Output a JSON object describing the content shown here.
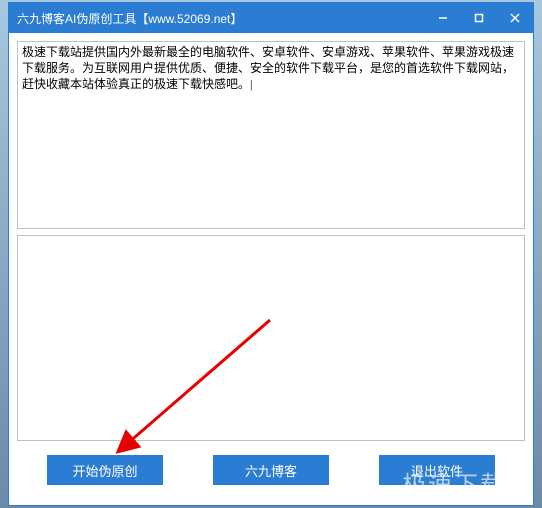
{
  "window": {
    "title": "六九博客AI伪原创工具【www.52069.net】"
  },
  "input": {
    "text": "极速下载站提供国内外最新最全的电脑软件、安卓软件、安卓游戏、苹果软件、苹果游戏极速下载服务。为互联网用户提供优质、便捷、安全的软件下载平台，是您的首选软件下载网站，赶快收藏本站体验真正的极速下载快感吧。|"
  },
  "output": {
    "text": ""
  },
  "buttons": {
    "start": "开始伪原创",
    "blog": "六九博客",
    "exit": "退出软件"
  },
  "watermark": "极速下载站"
}
